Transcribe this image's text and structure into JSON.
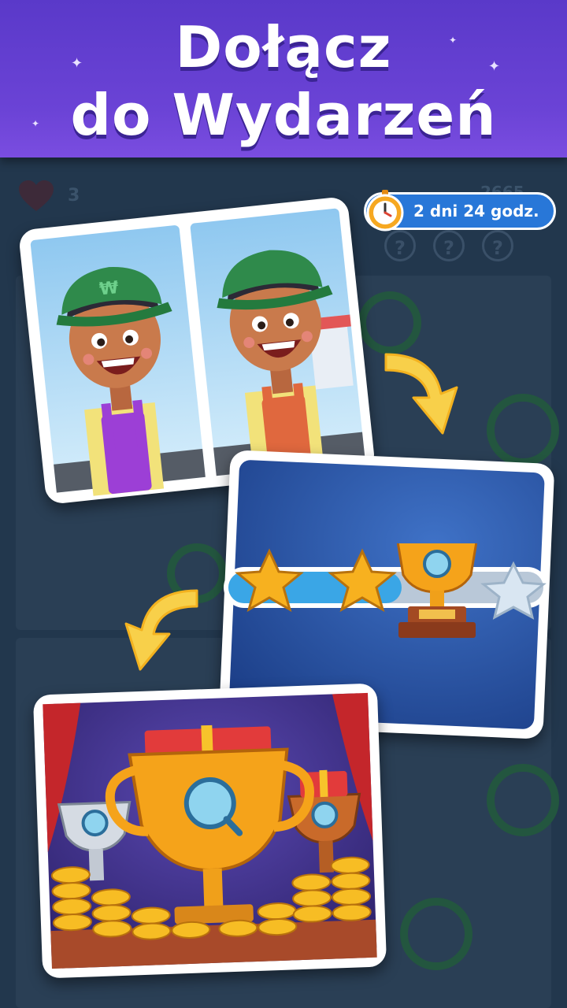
{
  "header": {
    "line1": "Dołącz",
    "line2": "do Wydarzeń"
  },
  "timer": {
    "text": "2 dni 24 godz.",
    "icon": "stopwatch-icon"
  },
  "background_game": {
    "lives": "3",
    "coins": "2665",
    "hint_symbol": "?"
  },
  "colors": {
    "header": "#6b43d6",
    "accent_blue": "#2877d8",
    "star_gold": "#f7b11f",
    "trophy_gold": "#f5a31a"
  }
}
